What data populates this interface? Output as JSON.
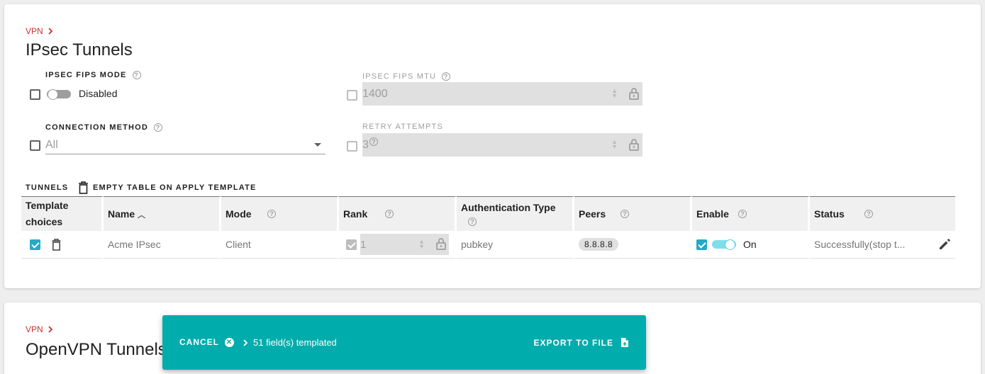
{
  "ipsec": {
    "breadcrumb": "VPN",
    "title": "IPsec Tunnels",
    "fips_mode": {
      "label": "IPSEC FIPS MODE",
      "value": "Disabled"
    },
    "fips_mtu": {
      "label": "IPSEC FIPS MTU",
      "value": "1400"
    },
    "connection_method": {
      "label": "CONNECTION METHOD",
      "value": "All"
    },
    "retry_attempts": {
      "label": "RETRY ATTEMPTS",
      "value": "3"
    },
    "tunnels_label": "TUNNELS",
    "empty_table_label": "EMPTY TABLE ON APPLY TEMPLATE",
    "table": {
      "headers": {
        "template": "Template choices",
        "name": "Name",
        "mode": "Mode",
        "rank": "Rank",
        "auth": "Authentication Type",
        "peers": "Peers",
        "enable": "Enable",
        "status": "Status"
      },
      "rows": [
        {
          "name": "Acme IPsec",
          "mode": "Client",
          "rank": "1",
          "auth": "pubkey",
          "peer": "8.8.8.8",
          "enable": "On",
          "status": "Successfully(stop t..."
        }
      ]
    }
  },
  "openvpn": {
    "breadcrumb": "VPN",
    "title": "OpenVPN Tunnels"
  },
  "snackbar": {
    "cancel": "CANCEL",
    "count": "51 field(s) templated",
    "export": "EXPORT TO FILE"
  },
  "colors": {
    "accent": "#00acac",
    "breadcrumb": "#d32f2f",
    "checkbox": "#26a9c6"
  },
  "icons": [
    "chevron-right-icon",
    "help-icon",
    "lock-icon",
    "trash-icon",
    "sort-up-icon",
    "edit-pencil-icon",
    "close-circle-icon",
    "file-export-icon"
  ]
}
